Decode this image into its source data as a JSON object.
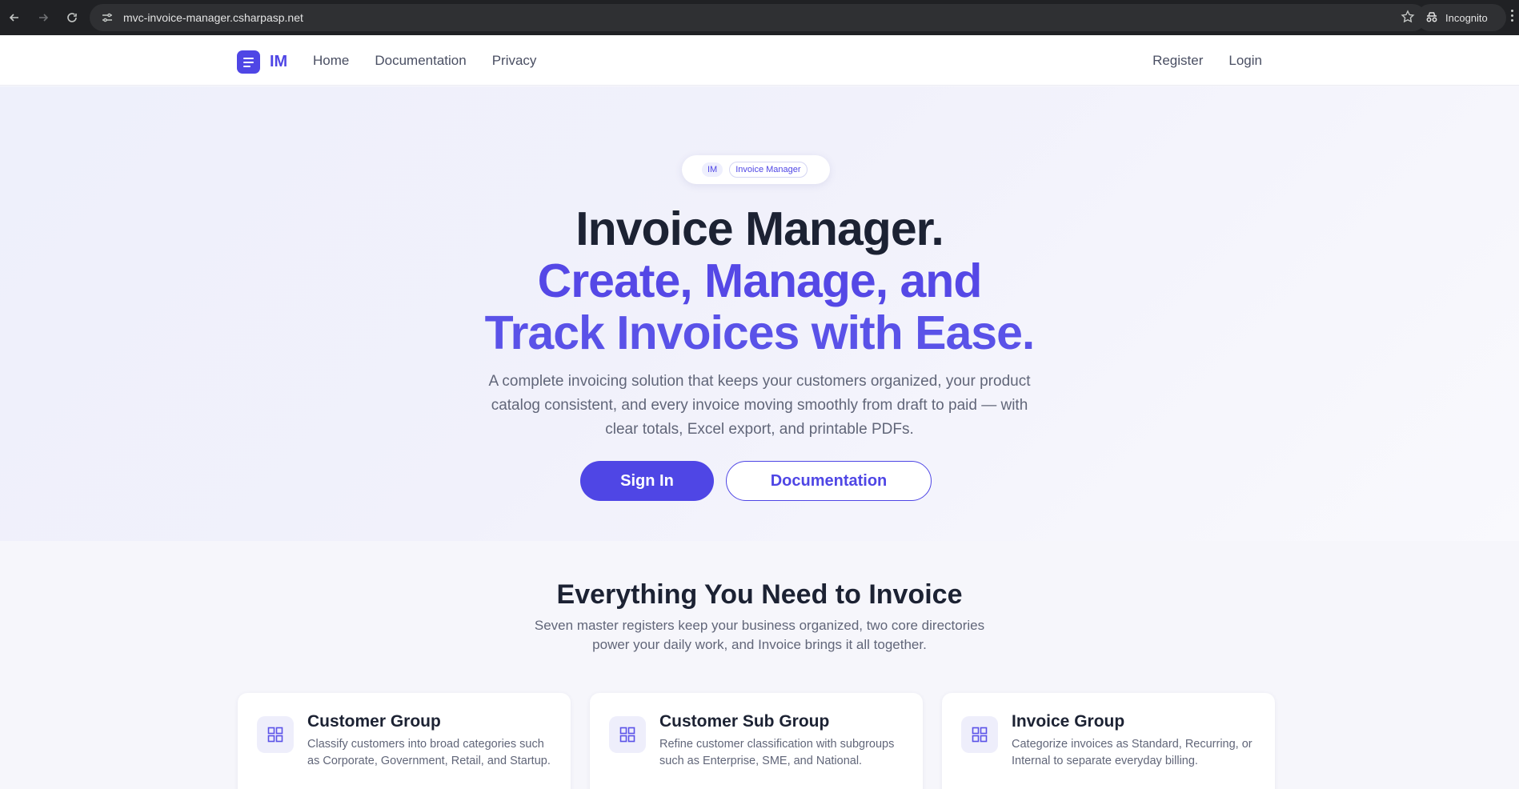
{
  "browser": {
    "url": "mvc-invoice-manager.csharpasp.net",
    "mode_label": "Incognito"
  },
  "nav": {
    "brand": "IM",
    "links": [
      "Home",
      "Documentation",
      "Privacy"
    ],
    "right_links": [
      "Register",
      "Login"
    ]
  },
  "hero": {
    "badge_short": "IM",
    "badge_name": "Invoice Manager",
    "title_line1": "Invoice Manager.",
    "title_line2": "Create, Manage, and",
    "title_line3": "Track Invoices with Ease.",
    "lead": "A complete invoicing solution that keeps your customers organized, your product catalog consistent, and every invoice moving smoothly from draft to paid — with clear totals, Excel export, and printable PDFs.",
    "primary_button": "Sign In",
    "secondary_button": "Documentation"
  },
  "features": {
    "title": "Everything You Need to Invoice",
    "subtitle": "Seven master registers keep your business organized, two core directories power your daily work, and Invoice brings it all together.",
    "cards": [
      {
        "title": "Customer Group",
        "text": "Classify customers into broad categories such as Corporate, Government, Retail, and Startup."
      },
      {
        "title": "Customer Sub Group",
        "text": "Refine customer classification with subgroups such as Enterprise, SME, and National."
      },
      {
        "title": "Invoice Group",
        "text": "Categorize invoices as Standard, Recurring, or Internal to separate everyday billing."
      }
    ]
  },
  "colors": {
    "accent": "#4f46e5",
    "heading": "#1c2233",
    "muted": "#616679"
  }
}
